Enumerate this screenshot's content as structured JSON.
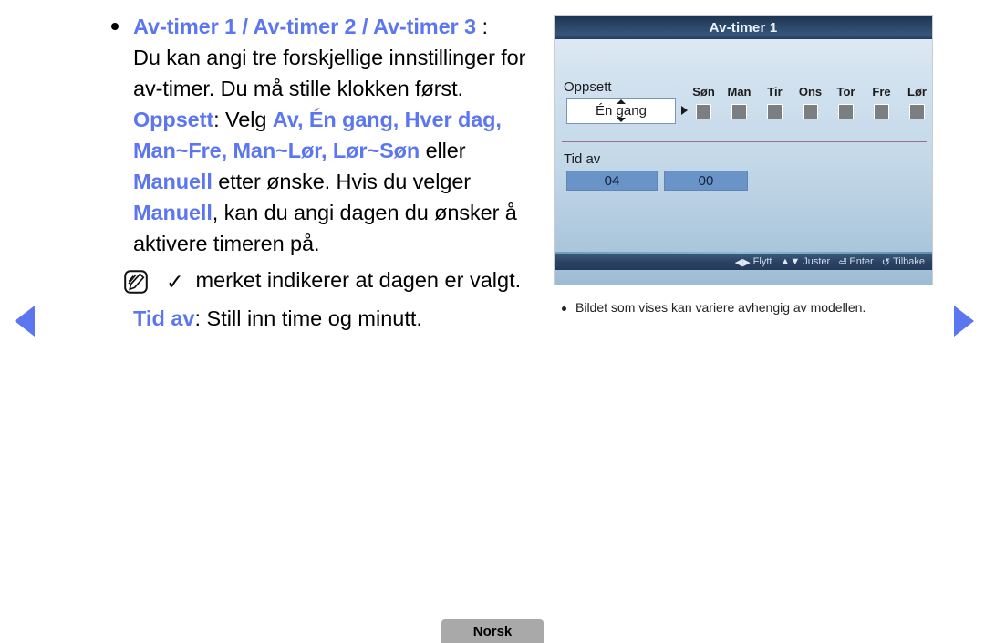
{
  "nav": {
    "prev_label": "previous-page",
    "next_label": "next-page"
  },
  "content": {
    "bullet_heading_hl": "Av-timer 1 / Av-timer 2 / Av-timer 3",
    "bullet_heading_tail": " :",
    "paragraph_1": "Du kan angi tre forskjellige innstillinger for av-timer. Du må stille klokken først.",
    "oppsett_term": "Oppsett",
    "oppsett_intro": ": Velg ",
    "oppsett_options": "Av, Én gang, Hver dag, Man~Fre, Man~Lør, Lør~Søn",
    "oppsett_mid": " eller ",
    "manuell_1": "Manuell",
    "manuell_tail_1": " etter ønske. Hvis du velger ",
    "manuell_2": "Manuell",
    "manuell_tail_2": ", kan du angi dagen du ønsker å aktivere timeren på.",
    "note_check_glyph": "✓",
    "note_text": " merket indikerer at dagen er valgt.",
    "tidav_term": "Tid av",
    "tidav_text": ": Still inn time og minutt."
  },
  "osd": {
    "title": "Av-timer 1",
    "setup_label": "Oppsett",
    "setup_value": "Én gang",
    "days": [
      {
        "name": "Søn",
        "checked": false
      },
      {
        "name": "Man",
        "checked": false
      },
      {
        "name": "Tir",
        "checked": false
      },
      {
        "name": "Ons",
        "checked": false
      },
      {
        "name": "Tor",
        "checked": false
      },
      {
        "name": "Fre",
        "checked": false
      },
      {
        "name": "Lør",
        "checked": false
      }
    ],
    "time_label": "Tid av",
    "time_hour": "04",
    "time_minute": "00",
    "hints": [
      {
        "glyph": "◀▶",
        "label": "Flytt"
      },
      {
        "glyph": "▲▼",
        "label": "Juster"
      },
      {
        "glyph": "⏎",
        "label": "Enter"
      },
      {
        "glyph": "↺",
        "label": "Tilbake"
      }
    ]
  },
  "caption": {
    "text": "Bildet som vises kan variere avhengig av modellen."
  },
  "footer": {
    "language": "Norsk"
  },
  "colors": {
    "accent_blue": "#5b76ef",
    "osd_title_bg": "#26405f",
    "time_field_bg": "#6a93c8",
    "divider": "#9c6f8f"
  }
}
